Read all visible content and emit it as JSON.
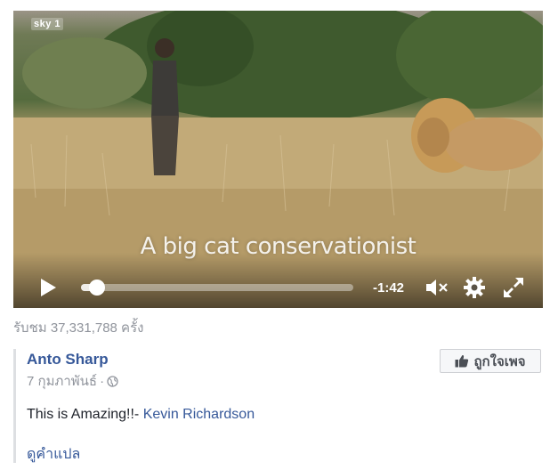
{
  "video": {
    "channel_logo": "sky 1",
    "subtitle": "A big cat conservationist",
    "time_remaining": "-1:42",
    "progress_fraction": 0.03
  },
  "views_text": "รับชม 37,331,788 ครั้ง",
  "post": {
    "author": "Anto Sharp",
    "date": "7 กุมภาพันธ์",
    "separator": "·",
    "like_page_label": "ถูกใจเพจ",
    "text_prefix": "This is Amazing!!- ",
    "tagged_name": "Kevin Richardson",
    "translate_label": "ดูคำแปล"
  },
  "icons": {
    "play": "play-icon",
    "mute": "volume-muted-icon",
    "settings": "gear-icon",
    "fullscreen": "fullscreen-icon",
    "privacy": "globe-icon",
    "like": "thumbs-up-icon"
  },
  "colors": {
    "link": "#365899",
    "meta": "#90949c",
    "text": "#1d2129"
  }
}
